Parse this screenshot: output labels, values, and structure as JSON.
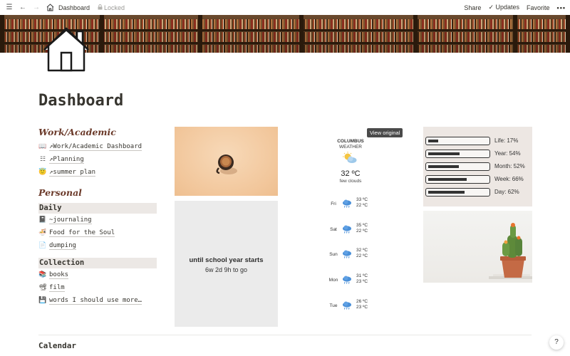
{
  "topbar": {
    "breadcrumb": "Dashboard",
    "locked": "Locked",
    "share": "Share",
    "updates": "Updates",
    "favorite": "Favorite"
  },
  "page": {
    "title": "Dashboard"
  },
  "work": {
    "heading": "Work/Academic",
    "links": [
      {
        "icon": "book-icon",
        "label": "↗Work/Academic Dashboard"
      },
      {
        "icon": "list-icon",
        "label": "↗Planning"
      },
      {
        "icon": "smiling-face-icon",
        "label": "↗summer plan"
      }
    ]
  },
  "personal": {
    "heading": "Personal",
    "daily": {
      "label": "Daily",
      "items": [
        {
          "icon": "notebook-icon",
          "label": "~journaling"
        },
        {
          "icon": "bowl-icon",
          "label": "Food for the Soul"
        },
        {
          "icon": "document-icon",
          "label": "dumping"
        }
      ]
    },
    "collection": {
      "label": "Collection",
      "items": [
        {
          "icon": "books-icon",
          "label": "books"
        },
        {
          "icon": "film-icon",
          "label": "film"
        },
        {
          "icon": "floppy-icon",
          "label": "words I should use more…"
        }
      ]
    }
  },
  "countdown": {
    "title": "until school year starts",
    "remaining": "6w 2d 9h to go"
  },
  "weather": {
    "view_original": "View original",
    "city": "COLUMBUS",
    "label": "WEATHER",
    "temp": "32 ºC",
    "desc": "few clouds",
    "forecast": [
      {
        "day": "Fri",
        "hi": "33 ºC",
        "lo": "22 ºC"
      },
      {
        "day": "Sat",
        "hi": "35 ºC",
        "lo": "22 ºC"
      },
      {
        "day": "Sun",
        "hi": "32 ºC",
        "lo": "22 ºC"
      },
      {
        "day": "Mon",
        "hi": "31 ºC",
        "lo": "23 ºC"
      },
      {
        "day": "Tue",
        "hi": "26 ºC",
        "lo": "23 ºC"
      }
    ]
  },
  "progress": [
    {
      "label": "Life: 17%",
      "fraction": 0.17
    },
    {
      "label": "Year: 54%",
      "fraction": 0.54
    },
    {
      "label": "Month: 52%",
      "fraction": 0.52
    },
    {
      "label": "Week: 66%",
      "fraction": 0.66
    },
    {
      "label": "Day: 62%",
      "fraction": 0.62
    }
  ],
  "calendar": {
    "heading": "Calendar"
  },
  "help": {
    "label": "?"
  },
  "colors": {
    "heading": "#6b3a2a",
    "group_bg": "#ece8e5",
    "progress_bg": "#ede7e3"
  }
}
